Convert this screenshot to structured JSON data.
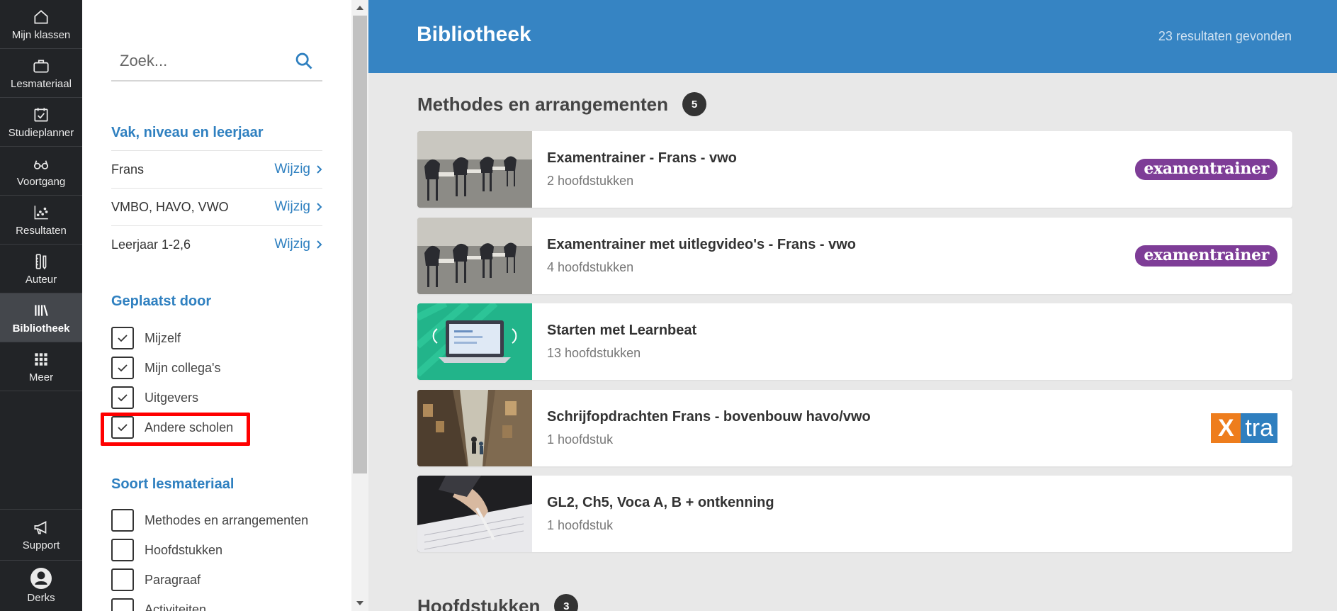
{
  "nav": {
    "items": [
      {
        "label": "Mijn klassen",
        "icon": "home-icon"
      },
      {
        "label": "Lesmateriaal",
        "icon": "briefcase-icon"
      },
      {
        "label": "Studieplanner",
        "icon": "calendar-check-icon"
      },
      {
        "label": "Voortgang",
        "icon": "glasses-icon"
      },
      {
        "label": "Resultaten",
        "icon": "scatter-chart-icon"
      },
      {
        "label": "Auteur",
        "icon": "author-tools-icon"
      },
      {
        "label": "Bibliotheek",
        "icon": "library-books-icon",
        "active": true
      },
      {
        "label": "Meer",
        "icon": "grid-icon"
      }
    ],
    "support_label": "Support",
    "user_label": "Derks"
  },
  "filter": {
    "search_placeholder": "Zoek...",
    "section1_title": "Vak, niveau en leerjaar",
    "rows": [
      {
        "label": "Frans",
        "action": "Wijzig"
      },
      {
        "label": "VMBO, HAVO, VWO",
        "action": "Wijzig"
      },
      {
        "label": "Leerjaar 1-2,6",
        "action": "Wijzig"
      }
    ],
    "section2_title": "Geplaatst door",
    "posted_by": [
      {
        "label": "Mijzelf",
        "checked": true
      },
      {
        "label": "Mijn collega's",
        "checked": true
      },
      {
        "label": "Uitgevers",
        "checked": true
      },
      {
        "label": "Andere scholen",
        "checked": true
      }
    ],
    "section3_title": "Soort lesmateriaal",
    "material_types": [
      {
        "label": "Methodes en arrangementen",
        "checked": false
      },
      {
        "label": "Hoofdstukken",
        "checked": false
      },
      {
        "label": "Paragraaf",
        "checked": false
      },
      {
        "label": "Activiteiten",
        "checked": false
      }
    ]
  },
  "header": {
    "title": "Bibliotheek",
    "result_count": "23 resultaten gevonden"
  },
  "groups": {
    "methods_title": "Methodes en arrangementen",
    "methods_count": "5",
    "chapters_title": "Hoofdstukken",
    "chapters_count": "3"
  },
  "cards": [
    {
      "title": "Examentrainer - Frans - vwo",
      "sub": "2 hoofdstukken",
      "badge": "examentrainer",
      "thumb": "classroom-chairs"
    },
    {
      "title": "Examentrainer met uitlegvideo's - Frans - vwo",
      "sub": "4 hoofdstukken",
      "badge": "examentrainer",
      "thumb": "classroom-chairs"
    },
    {
      "title": "Starten met Learnbeat",
      "sub": "13 hoofdstukken",
      "badge": "",
      "thumb": "laptop-illustration"
    },
    {
      "title": "Schrijfopdrachten Frans - bovenbouw havo/vwo",
      "sub": "1 hoofdstuk",
      "badge": "xtra",
      "badge_x": "X",
      "badge_tra": "tra",
      "thumb": "street-photo"
    },
    {
      "title": "GL2, Ch5, Voca A, B + ontkenning",
      "sub": "1 hoofdstuk",
      "badge": "",
      "thumb": "writing-hand"
    }
  ],
  "colors": {
    "nav_bg": "#222427",
    "header_blue": "#3684c3",
    "link_blue": "#2f80c0",
    "examentrainer_purple": "#7e3d97",
    "xtra_orange": "#ee7d1d",
    "highlight_red": "#ff0000"
  }
}
